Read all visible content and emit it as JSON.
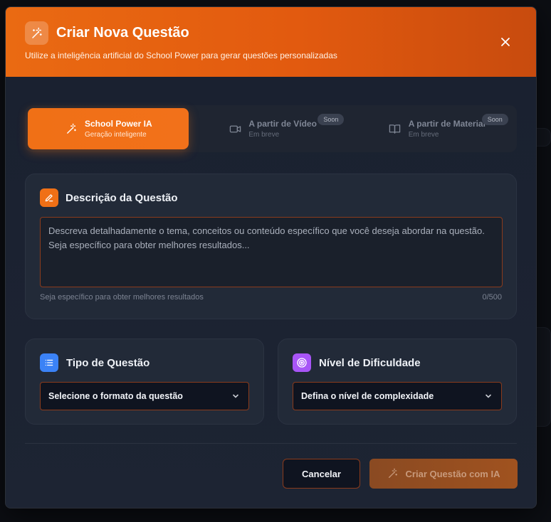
{
  "modal": {
    "title": "Criar Nova Questão",
    "subtitle": "Utilize a inteligência artificial do School Power para gerar questões personalizadas"
  },
  "tabs": [
    {
      "title": "School Power IA",
      "subtitle": "Geração inteligente",
      "icon": "magic-wand-icon",
      "active": true
    },
    {
      "title": "A partir de Vídeo",
      "subtitle": "Em breve",
      "badge": "Soon",
      "icon": "video-icon",
      "active": false
    },
    {
      "title": "A partir de Material",
      "subtitle": "Em breve",
      "badge": "Soon",
      "icon": "book-icon",
      "active": false
    }
  ],
  "description": {
    "title": "Descrição da Questão",
    "placeholder": "Descreva detalhadamente o tema, conceitos ou conteúdo específico que você deseja abordar na questão. Seja específico para obter melhores resultados...",
    "value": "",
    "hint": "Seja específico para obter melhores resultados",
    "counter": "0/500"
  },
  "question_type": {
    "title": "Tipo de Questão",
    "selected": "Selecione o formato da questão"
  },
  "difficulty": {
    "title": "Nível de Dificuldade",
    "selected": "Defina o nível de complexidade"
  },
  "footer": {
    "cancel_label": "Cancelar",
    "create_label": "Criar Questão com IA"
  },
  "colors": {
    "accent": "#f07016",
    "header_start": "#ea6a12",
    "header_end": "#c84b0e",
    "panel_bg": "#222a38",
    "list_icon_bg": "#3b82f6",
    "target_icon_bg": "#a855f7"
  },
  "background": {
    "close_glyph": "×"
  }
}
